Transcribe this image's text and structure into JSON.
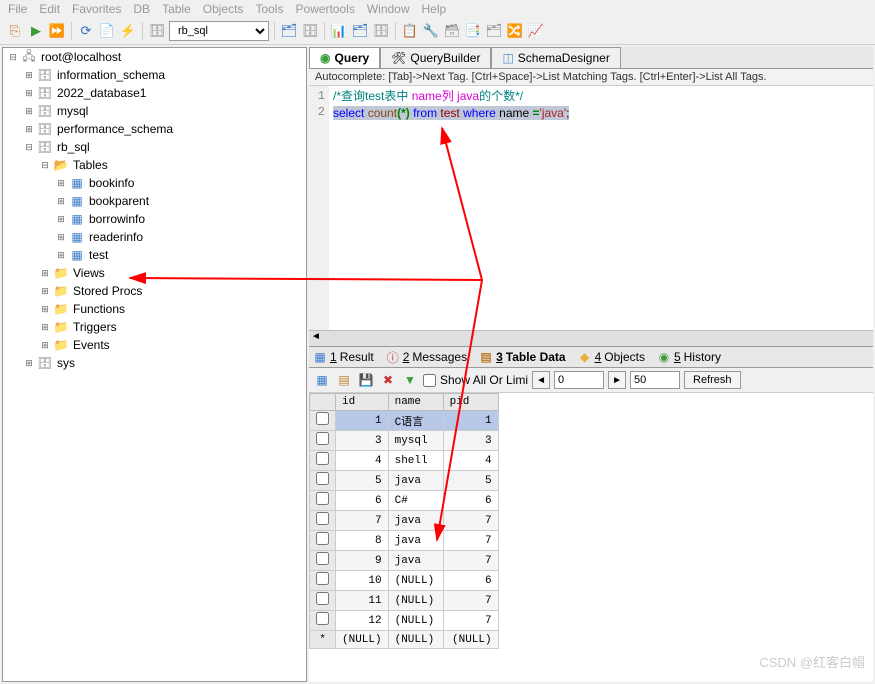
{
  "menubar": [
    "File",
    "Edit",
    "Favorites",
    "DB",
    "Table",
    "Objects",
    "Tools",
    "Powertools",
    "Window",
    "Help"
  ],
  "toolbar": {
    "db_selector": "rb_sql"
  },
  "tree": {
    "root": "root@localhost",
    "databases": [
      {
        "name": "information_schema",
        "expanded": false
      },
      {
        "name": "2022_database1",
        "expanded": false
      },
      {
        "name": "mysql",
        "expanded": false
      },
      {
        "name": "performance_schema",
        "expanded": false
      },
      {
        "name": "rb_sql",
        "expanded": true,
        "children": [
          {
            "name": "Tables",
            "expanded": true,
            "type": "folder-open",
            "children": [
              {
                "name": "bookinfo",
                "type": "table"
              },
              {
                "name": "bookparent",
                "type": "table"
              },
              {
                "name": "borrowinfo",
                "type": "table"
              },
              {
                "name": "readerinfo",
                "type": "table"
              },
              {
                "name": "test",
                "type": "table"
              }
            ]
          },
          {
            "name": "Views",
            "type": "folder"
          },
          {
            "name": "Stored Procs",
            "type": "folder"
          },
          {
            "name": "Functions",
            "type": "folder"
          },
          {
            "name": "Triggers",
            "type": "folder"
          },
          {
            "name": "Events",
            "type": "folder"
          }
        ]
      },
      {
        "name": "sys",
        "expanded": false
      }
    ]
  },
  "top_tabs": [
    {
      "label": "Query",
      "active": true
    },
    {
      "label": "QueryBuilder",
      "active": false
    },
    {
      "label": "SchemaDesigner",
      "active": false
    }
  ],
  "hint": "Autocomplete: [Tab]->Next Tag. [Ctrl+Space]->List Matching Tags. [Ctrl+Enter]->List All Tags.",
  "editor": {
    "line1_comment_prefix": "/*查询test表中 ",
    "line1_comment_name": "name列 java",
    "line1_comment_suffix": "的个数*/",
    "kw_select": "select",
    "fn_count": "count",
    "paren_open": "(",
    "star": "*",
    "paren_close": ")",
    "kw_from": "from",
    "tbl_test": "test",
    "kw_where": "where",
    "col_name": "name",
    "eq": "=",
    "str_java": "'java'",
    "semi": ";"
  },
  "result_tabs": [
    {
      "num": "1",
      "label": "Result",
      "icon": "grid"
    },
    {
      "num": "2",
      "label": "Messages",
      "icon": "info"
    },
    {
      "num": "3",
      "label": "Table Data",
      "icon": "table",
      "active": true
    },
    {
      "num": "4",
      "label": "Objects",
      "icon": "objects"
    },
    {
      "num": "5",
      "label": "History",
      "icon": "history"
    }
  ],
  "data_controls": {
    "show_label": "Show All Or  Limi",
    "offset": "0",
    "limit": "50",
    "refresh": "Refresh"
  },
  "grid": {
    "columns": [
      "id",
      "name",
      "pid"
    ],
    "rows": [
      {
        "id": "1",
        "name": "C语言",
        "pid": "1",
        "selected": true
      },
      {
        "id": "3",
        "name": "mysql",
        "pid": "3"
      },
      {
        "id": "4",
        "name": "shell",
        "pid": "4"
      },
      {
        "id": "5",
        "name": "java",
        "pid": "5"
      },
      {
        "id": "6",
        "name": "C#",
        "pid": "6"
      },
      {
        "id": "7",
        "name": "java",
        "pid": "7"
      },
      {
        "id": "8",
        "name": "java",
        "pid": "7"
      },
      {
        "id": "9",
        "name": "java",
        "pid": "7"
      },
      {
        "id": "10",
        "name": "(NULL)",
        "pid": "6"
      },
      {
        "id": "11",
        "name": "(NULL)",
        "pid": "7"
      },
      {
        "id": "12",
        "name": "(NULL)",
        "pid": "7"
      }
    ],
    "newrow": {
      "marker": "*",
      "id": "(NULL)",
      "name": "(NULL)",
      "pid": "(NULL)"
    }
  },
  "watermark": "CSDN @红客白帽"
}
